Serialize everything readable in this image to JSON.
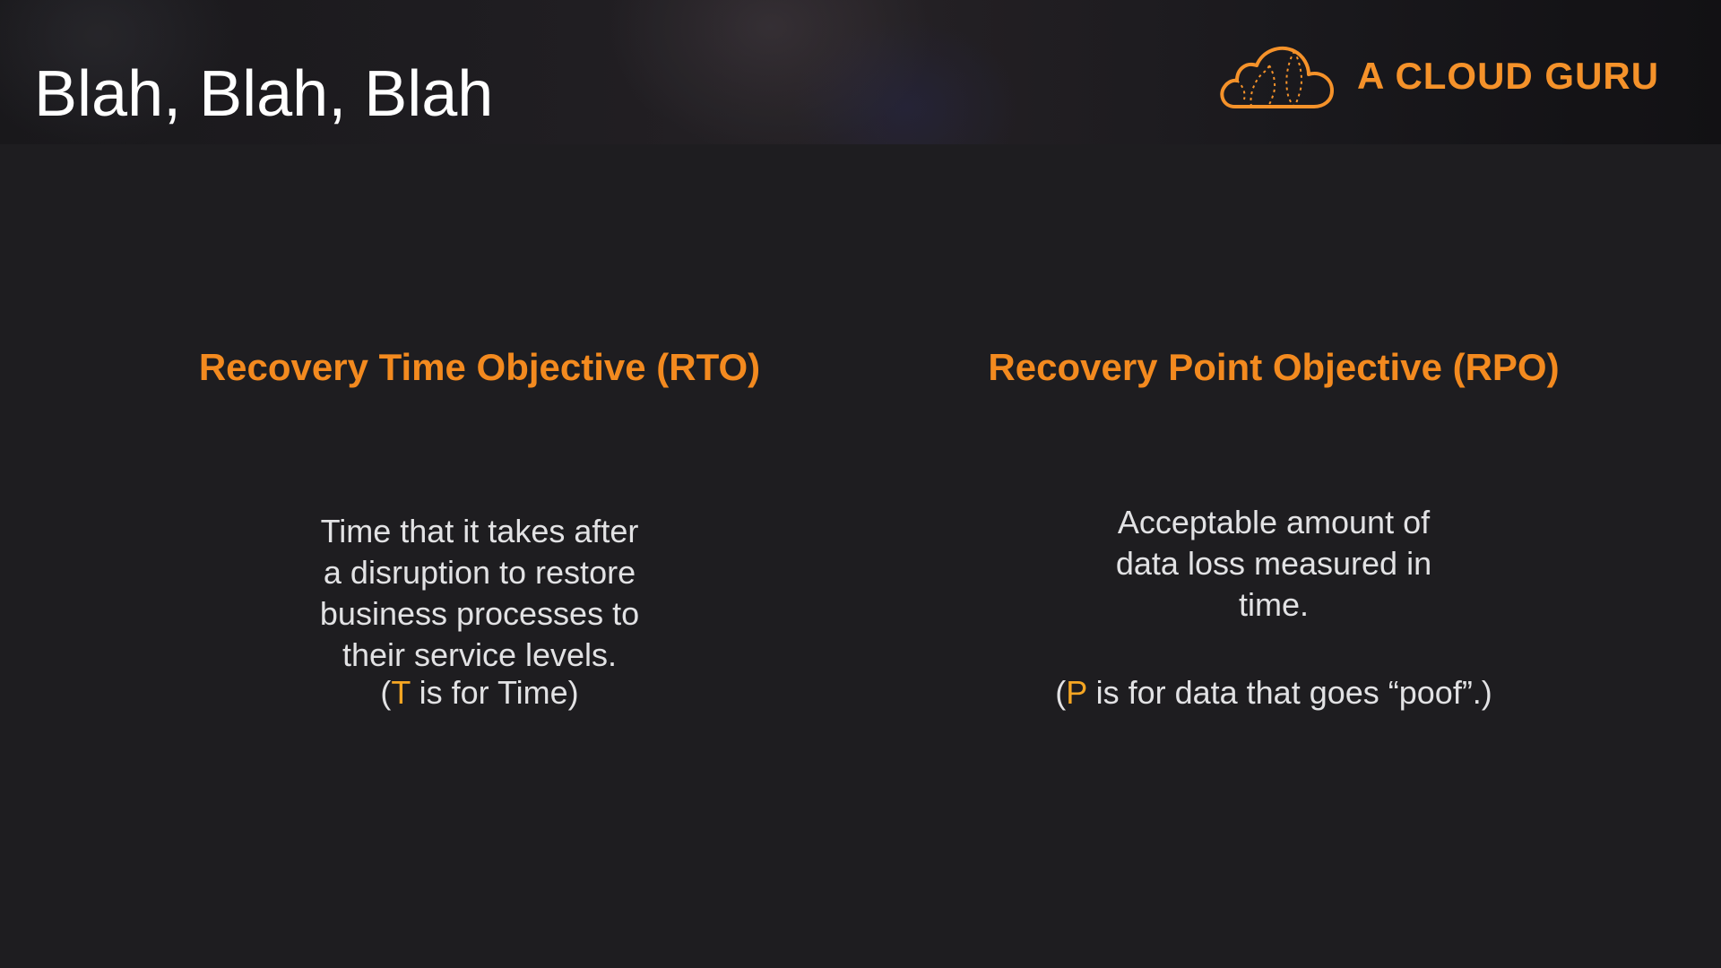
{
  "header": {
    "title": "Blah, Blah, Blah",
    "brand": {
      "name": "A CLOUD GURU",
      "icon": "cloud-icon",
      "color": "#f5922a"
    }
  },
  "columns": [
    {
      "heading": "Recovery Time Objective (RTO)",
      "lines": [
        "Time that it takes after",
        "a disruption to restore",
        "business processes to",
        "their service levels."
      ],
      "note": {
        "open": "(",
        "letter": "T",
        "rest": " is for Time)"
      }
    },
    {
      "heading": "Recovery Point Objective (RPO)",
      "lines": [
        "Acceptable amount of",
        "data loss measured in",
        "time."
      ],
      "note": {
        "open": "(",
        "letter": "P",
        "rest": " is for data that goes “poof”.)"
      }
    }
  ],
  "colors": {
    "background": "#1e1d20",
    "heading": "#f38a1f",
    "accent_letter": "#f5a623",
    "body_text": "#e2e2e4",
    "title_text": "#ffffff"
  }
}
